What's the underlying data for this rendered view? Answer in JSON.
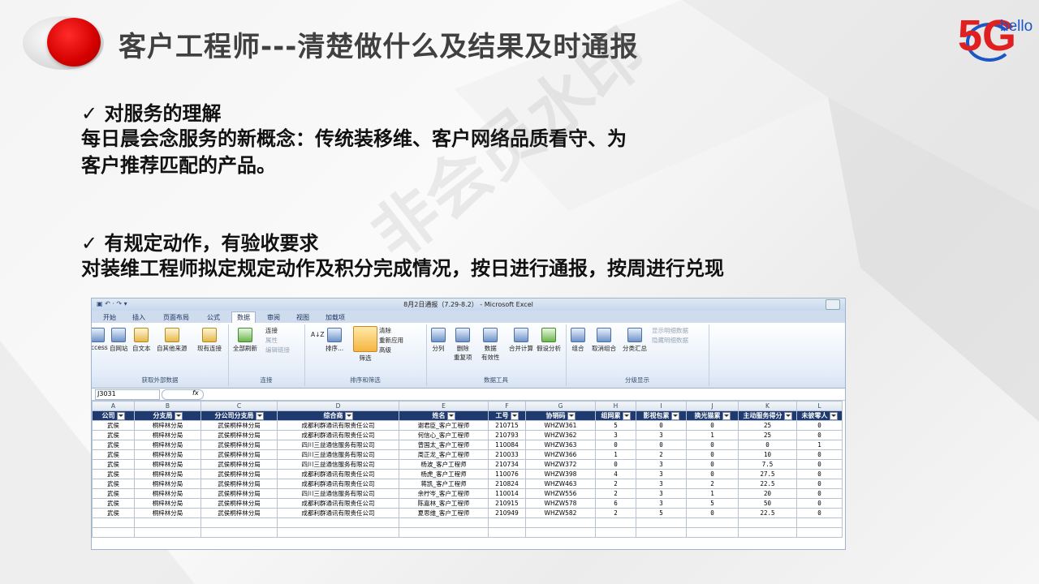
{
  "header": {
    "title": "客户工程师---清楚做什么及结果及时通报",
    "brand_mark": "5G",
    "brand_word": "hello",
    "accent_red": "#d40000",
    "accent_blue": "#1a56c6"
  },
  "content": {
    "section1_heading": "✓ 对服务的理解",
    "section1_line1": "每日晨会念服务的新概念：传统装移维、客户网络品质看守、为",
    "section1_line2": "客户推荐匹配的产品。",
    "section2_heading": "✓ 有规定动作，有验收要求",
    "section2_line1": "对装维工程师拟定规定动作及积分完成情况，按日进行通报，按周进行兑现"
  },
  "watermark": "非会员水印",
  "excel": {
    "title": "8月2日通报（7.29-8.2） - Microsoft Excel",
    "tabs": [
      "开始",
      "插入",
      "页面布局",
      "公式",
      "数据",
      "审阅",
      "视图",
      "加载项"
    ],
    "active_tab": "数据",
    "ribbon": {
      "group1_label": "获取外部数据",
      "access": "Access",
      "web": "自网站",
      "text": "自文本",
      "other": "自其他来源",
      "existing": "现有连接",
      "group2_label": "连接",
      "refresh_all": "全部刷新",
      "connections": "连接",
      "properties": "属性",
      "edit_links": "编辑链接",
      "group3_label": "排序和筛选",
      "sort": "排序...",
      "filter": "筛选",
      "clear": "清除",
      "reapply": "重新应用",
      "advanced": "高级",
      "group4_label": "数据工具",
      "split": "分列",
      "remove_dup_1": "删除",
      "remove_dup_2": "重复项",
      "validation_1": "数据",
      "validation_2": "有效性",
      "consolidate": "合并计算",
      "whatif": "假设分析",
      "group5_label": "分级显示",
      "group": "组合",
      "ungroup": "取消组合",
      "subtotal": "分类汇总",
      "show_detail": "显示明细数据",
      "hide_detail": "隐藏明细数据"
    },
    "name_box": "J3031",
    "fx": "fx",
    "col_letters": [
      "A",
      "B",
      "C",
      "D",
      "E",
      "F",
      "G",
      "H",
      "I",
      "J",
      "K",
      "L"
    ],
    "headers": [
      "公司",
      "分支局",
      "分公司分支局",
      "综合商",
      "姓名",
      "工号",
      "协销码",
      "组网累",
      "影视包累",
      "换光猫累",
      "主动服务得分",
      "未彼零人"
    ],
    "rows": [
      [
        "武侯",
        "桐梓林分局",
        "武侯桐梓林分局",
        "成都利群通讯有限责任公司",
        "谢君臣_客户工程师",
        "210715",
        "WHZW361",
        "5",
        "0",
        "0",
        "25",
        "0"
      ],
      [
        "武侯",
        "桐梓林分局",
        "武侯桐梓林分局",
        "成都利群通讯有限责任公司",
        "何信心_客户工程师",
        "210793",
        "WHZW362",
        "3",
        "3",
        "1",
        "25",
        "0"
      ],
      [
        "武侯",
        "桐梓林分局",
        "武侯桐梓林分局",
        "四川三益通信服务有限公司",
        "曾国太_客户工程师",
        "110084",
        "WHZW363",
        "0",
        "0",
        "0",
        "0",
        "1"
      ],
      [
        "武侯",
        "桐梓林分局",
        "武侯桐梓林分局",
        "四川三益通信服务有限公司",
        "周正龙_客户工程师",
        "210033",
        "WHZW366",
        "1",
        "2",
        "0",
        "10",
        "0"
      ],
      [
        "武侯",
        "桐梓林分局",
        "武侯桐梓林分局",
        "四川三益通信服务有限公司",
        "杨波_客户工程师",
        "210734",
        "WHZW372",
        "0",
        "3",
        "0",
        "7.5",
        "0"
      ],
      [
        "武侯",
        "桐梓林分局",
        "武侯桐梓林分局",
        "成都利群通讯有限责任公司",
        "杨虎_客户工程师",
        "110076",
        "WHZW398",
        "4",
        "3",
        "0",
        "27.5",
        "0"
      ],
      [
        "武侯",
        "桐梓林分局",
        "武侯桐梓林分局",
        "成都利群通讯有限责任公司",
        "蒋凯_客户工程师",
        "210824",
        "WHZW463",
        "2",
        "3",
        "2",
        "22.5",
        "0"
      ],
      [
        "武侯",
        "桐梓林分局",
        "武侯桐梓林分局",
        "四川三益通信服务有限公司",
        "余柠岑_客户工程师",
        "110014",
        "WHZW556",
        "2",
        "3",
        "1",
        "20",
        "0"
      ],
      [
        "武侯",
        "桐梓林分局",
        "武侯桐梓林分局",
        "成都利群通讯有限责任公司",
        "陈嘉林_客户工程师",
        "210915",
        "WHZW578",
        "6",
        "3",
        "5",
        "50",
        "0"
      ],
      [
        "武侯",
        "桐梓林分局",
        "武侯桐梓林分局",
        "成都利群通讯有限责任公司",
        "夏思维_客户工程师",
        "210949",
        "WHZW582",
        "2",
        "5",
        "0",
        "22.5",
        "0"
      ]
    ]
  }
}
